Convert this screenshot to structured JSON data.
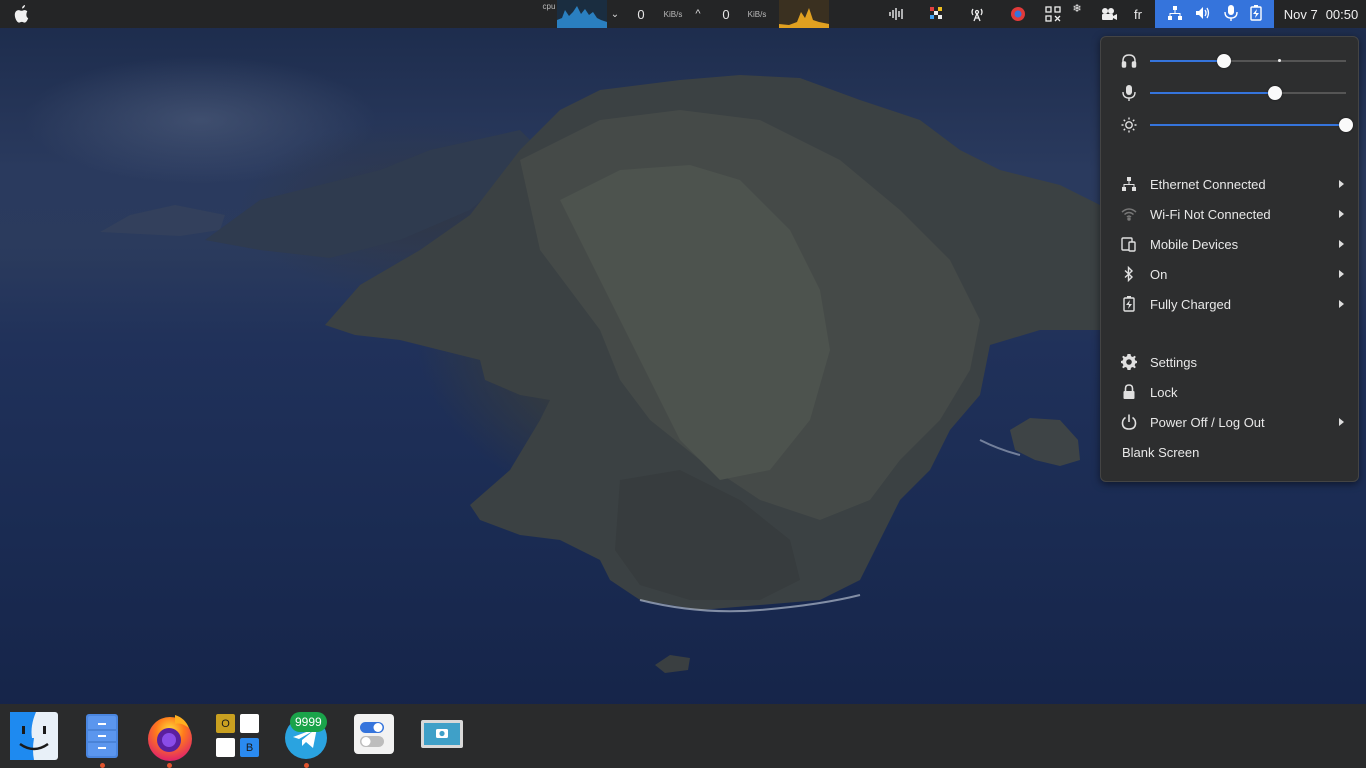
{
  "top_panel": {
    "apple_menu_icon": "apple-logo-icon",
    "cpu_label": "cpu",
    "net_down_value": "0",
    "net_down_unit": "KiB/s",
    "net_up_value": "0",
    "net_up_unit": "KiB/s",
    "keyboard_layout": "fr",
    "date": "Nov 7",
    "time": "00:50"
  },
  "system_menu": {
    "sliders": [
      {
        "name": "headphones-volume",
        "icon": "headphones-icon",
        "level": 0.38
      },
      {
        "name": "microphone-volume",
        "icon": "microphone-icon",
        "level": 0.64
      },
      {
        "name": "brightness",
        "icon": "brightness-icon",
        "level": 1.0
      }
    ],
    "items": {
      "ethernet": "Ethernet Connected",
      "wifi": "Wi-Fi Not Connected",
      "mobile": "Mobile Devices",
      "bluetooth": "On",
      "battery": "Fully Charged",
      "settings": "Settings",
      "lock": "Lock",
      "power": "Power Off / Log Out",
      "blank": "Blank Screen"
    }
  },
  "dock": {
    "telegram_badge": "9999",
    "office_letters": [
      "O",
      "B"
    ]
  },
  "colors": {
    "panel": "#242526",
    "accent": "#3574dc",
    "menu_bg": "#2d2e2f",
    "dock_bg": "#2a2b2c",
    "running_dot": "#e0542e"
  }
}
